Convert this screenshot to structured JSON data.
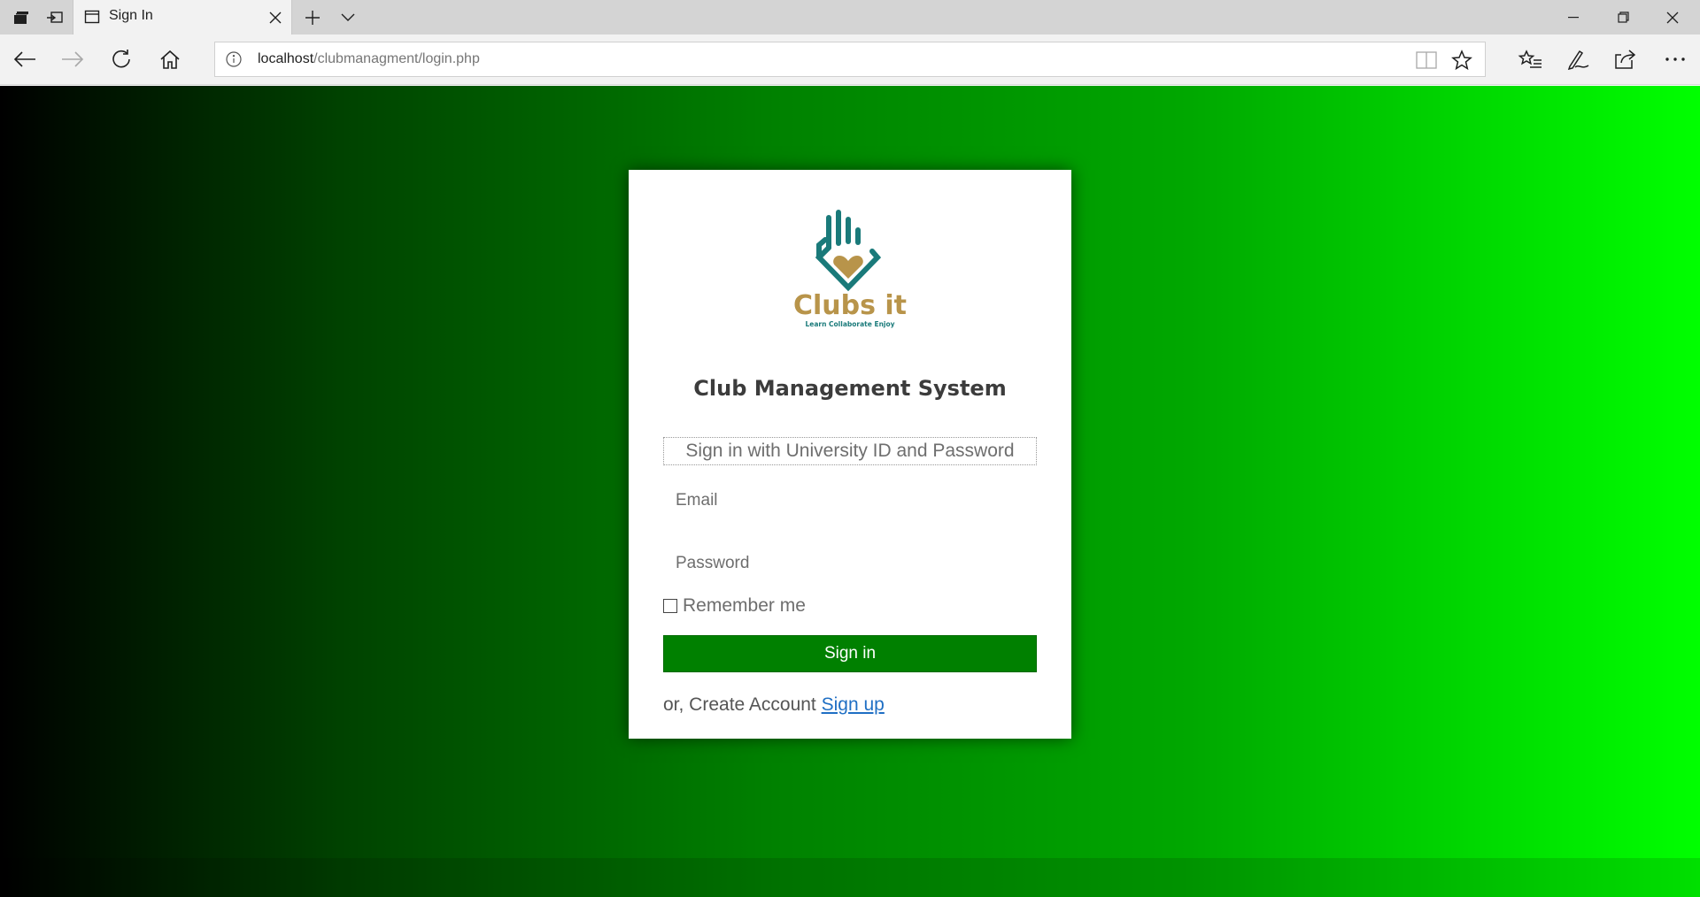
{
  "browser": {
    "tab": {
      "title": "Sign In",
      "close_icon": "close-icon"
    },
    "address": {
      "host": "localhost",
      "path": "/clubmanagment/login.php"
    },
    "icons": {
      "tab_actions": "tab-actions-icon",
      "set_aside": "set-aside-icon",
      "new_tab": "plus-icon",
      "tab_list": "chevron-down-icon",
      "minimize": "minimize-icon",
      "restore": "restore-icon",
      "close": "close-icon",
      "back": "arrow-left-icon",
      "forward": "arrow-right-icon",
      "refresh": "refresh-icon",
      "home": "home-icon",
      "reading_view": "book-icon",
      "favorite": "star-icon",
      "favorites_hub": "star-list-icon",
      "notes": "pen-icon",
      "share": "share-icon",
      "more": "ellipsis-icon"
    }
  },
  "page": {
    "background_colors": [
      "#000000",
      "#008000",
      "#00ff00"
    ],
    "logo": {
      "brand": "Clubs it",
      "tagline": "Learn  Collaborate  Enjoy",
      "colors": {
        "teal": "#1a7a7a",
        "gold": "#b8944a"
      }
    },
    "title": "Club Management System",
    "legend": "Sign in with University ID and Password",
    "email_placeholder": "Email",
    "password_placeholder": "Password",
    "remember_label": "Remember me",
    "signin_label": "Sign in",
    "signin_color": "#008000",
    "signup_prefix": "or, Create Account ",
    "signup_link": "Sign up"
  }
}
